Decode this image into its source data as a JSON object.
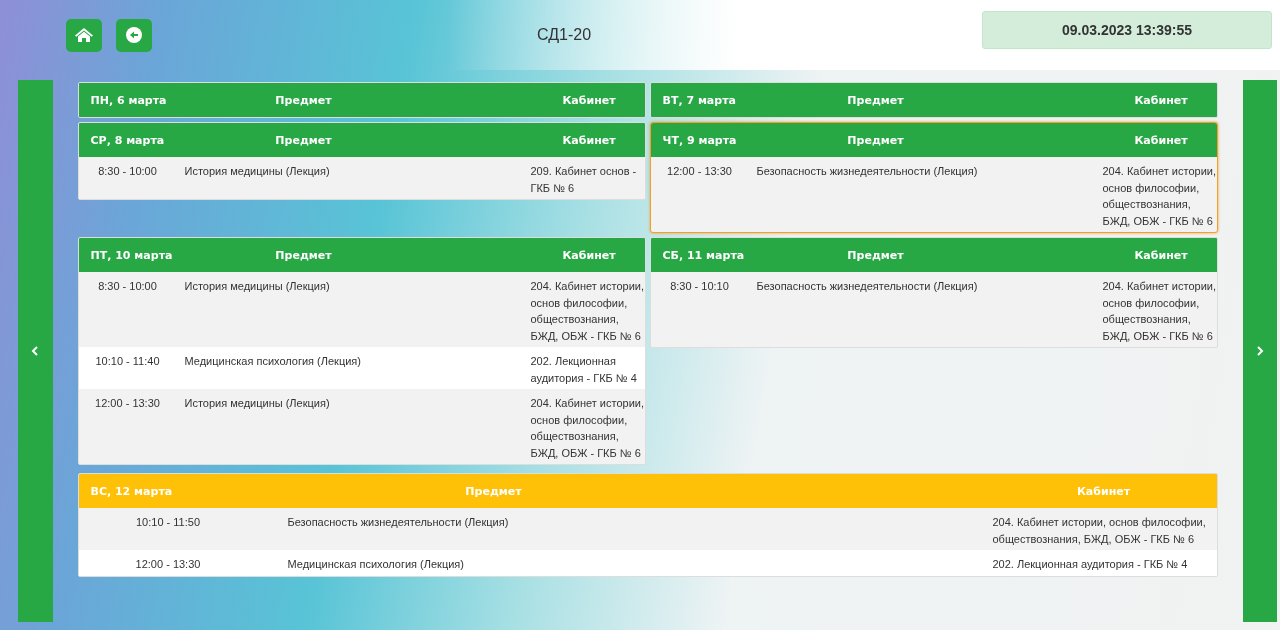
{
  "header": {
    "title": "СД1-20",
    "datetime": "09.03.2023 13:39:55"
  },
  "days": [
    {
      "date": "ПН, 6 марта",
      "subject_heading": "Предмет",
      "room_heading": "Кабинет",
      "today": false,
      "wide": false,
      "color": "#28a745"
    },
    {
      "date": "ВТ, 7 марта",
      "subject_heading": "Предмет",
      "room_heading": "Кабинет",
      "today": false,
      "wide": false,
      "color": "#28a745"
    },
    {
      "date": "СР, 8 марта",
      "subject_heading": "Предмет",
      "room_heading": "Кабинет",
      "today": false,
      "wide": false,
      "color": "#28a745",
      "lessons": [
        {
          "time": "8:30 - 10:00",
          "subject": "История медицины (Лекция)",
          "room": "209. Кабинет основ - ГКБ № 6"
        }
      ]
    },
    {
      "date": "ЧТ, 9 марта",
      "subject_heading": "Предмет",
      "room_heading": "Кабинет",
      "today": true,
      "wide": false,
      "color": "#28a745",
      "lessons": [
        {
          "time": "12:00 - 13:30",
          "subject": "Безопасность жизнедеятельности (Лекция)",
          "room": "204. Кабинет истории, основ философии, обществознания, БЖД, ОБЖ - ГКБ № 6"
        }
      ]
    },
    {
      "date": "ПТ, 10 марта",
      "subject_heading": "Предмет",
      "room_heading": "Кабинет",
      "today": false,
      "wide": false,
      "color": "#28a745",
      "lessons": [
        {
          "time": "8:30 - 10:00",
          "subject": "История медицины (Лекция)",
          "room": "204. Кабинет истории, основ философии, обществознания, БЖД, ОБЖ - ГКБ № 6"
        },
        {
          "time": "10:10 - 11:40",
          "subject": "Медицинская психология (Лекция)",
          "room": "202. Лекционная аудитория - ГКБ № 4"
        },
        {
          "time": "12:00 - 13:30",
          "subject": "История медицины (Лекция)",
          "room": "204. Кабинет истории, основ философии, обществознания, БЖД, ОБЖ - ГКБ № 6"
        }
      ]
    },
    {
      "date": "СБ, 11 марта",
      "subject_heading": "Предмет",
      "room_heading": "Кабинет",
      "today": false,
      "wide": false,
      "color": "#28a745",
      "lessons": [
        {
          "time": "8:30 - 10:10",
          "subject": "Безопасность жизнедеятельности (Лекция)",
          "room": "204. Кабинет истории, основ философии, обществознания, БЖД, ОБЖ - ГКБ № 6"
        }
      ]
    },
    {
      "date": "ВС, 12 марта",
      "subject_heading": "Предмет",
      "room_heading": "Кабинет",
      "today": false,
      "wide": true,
      "color": "#ffc107",
      "lessons": [
        {
          "time": "10:10 - 11:50",
          "subject": "Безопасность жизнедеятельности (Лекция)",
          "room": "204. Кабинет истории, основ философии, обществознания, БЖД, ОБЖ - ГКБ № 6"
        },
        {
          "time": "12:00 - 13:30",
          "subject": "Медицинская психология (Лекция)",
          "room": "202. Лекционная аудитория - ГКБ № 4"
        }
      ]
    }
  ]
}
